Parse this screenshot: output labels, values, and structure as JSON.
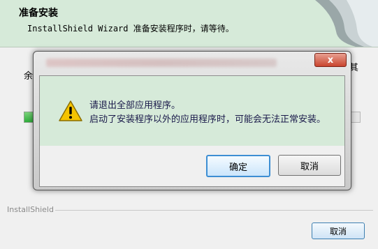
{
  "installer": {
    "title": "准备安装",
    "subtitle": "InstallShield Wizard 准备安装程序时，请等待。",
    "body_left_fragment": "余",
    "body_right_fragment": "其",
    "footer_label": "InstallShield",
    "cancel_label": "取消"
  },
  "dialog": {
    "close_label": "x",
    "message_line1": "请退出全部应用程序。",
    "message_line2": "启动了安装程序以外的应用程序时，可能会无法正常安装。",
    "ok_label": "确定",
    "cancel_label": "取消"
  },
  "icons": {
    "warning": "warning-icon",
    "close": "close-icon"
  },
  "colors": {
    "header_bg": "#d6ead9",
    "close_red": "#c9452f",
    "focus_blue": "#3d8ed3"
  }
}
